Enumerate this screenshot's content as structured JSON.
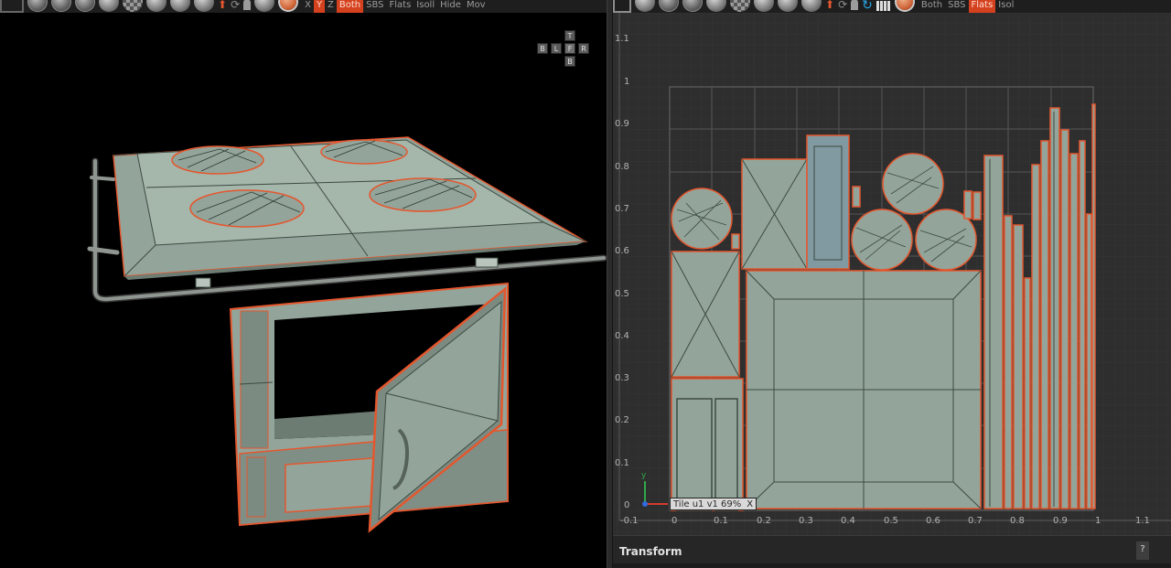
{
  "left_toolbar": {
    "labels": [
      "X",
      "Y",
      "Z",
      "Both",
      "SBS",
      "Flats",
      "Isoll",
      "Hide",
      "Mov"
    ],
    "active_label": "Both"
  },
  "right_toolbar": {
    "labels": [
      "Both",
      "SBS",
      "Flats",
      "Isol"
    ],
    "active_label": "Flats"
  },
  "view_cube": {
    "top": "T",
    "bottom": "B",
    "left": "L",
    "front": "F",
    "right": "R",
    "back": "B"
  },
  "uv_ruler": {
    "y_ticks": [
      "1.1",
      "1",
      "0.9",
      "0.8",
      "0.7",
      "0.6",
      "0.5",
      "0.4",
      "0.3",
      "0.2",
      "0.1",
      "0"
    ],
    "x_ticks": [
      "-0.1",
      "0",
      "0.1",
      "0.2",
      "0.3",
      "0.4",
      "0.5",
      "0.6",
      "0.7",
      "0.8",
      "0.9",
      "1",
      "1.1"
    ]
  },
  "axis_gizmo": {
    "x_label": "x",
    "y_label": "y"
  },
  "tile_tag": {
    "text": "Tile u1 v1 69%",
    "close": "X"
  },
  "transform_panel": {
    "title": "Transform",
    "help": "?"
  },
  "colors": {
    "accent_orange": "#d4411f",
    "mesh_fill": "#93a59a",
    "uv_edge": "#e4572e",
    "uv_bg": "#2e2e2e",
    "active_icon_blue": "#29a8e6"
  }
}
